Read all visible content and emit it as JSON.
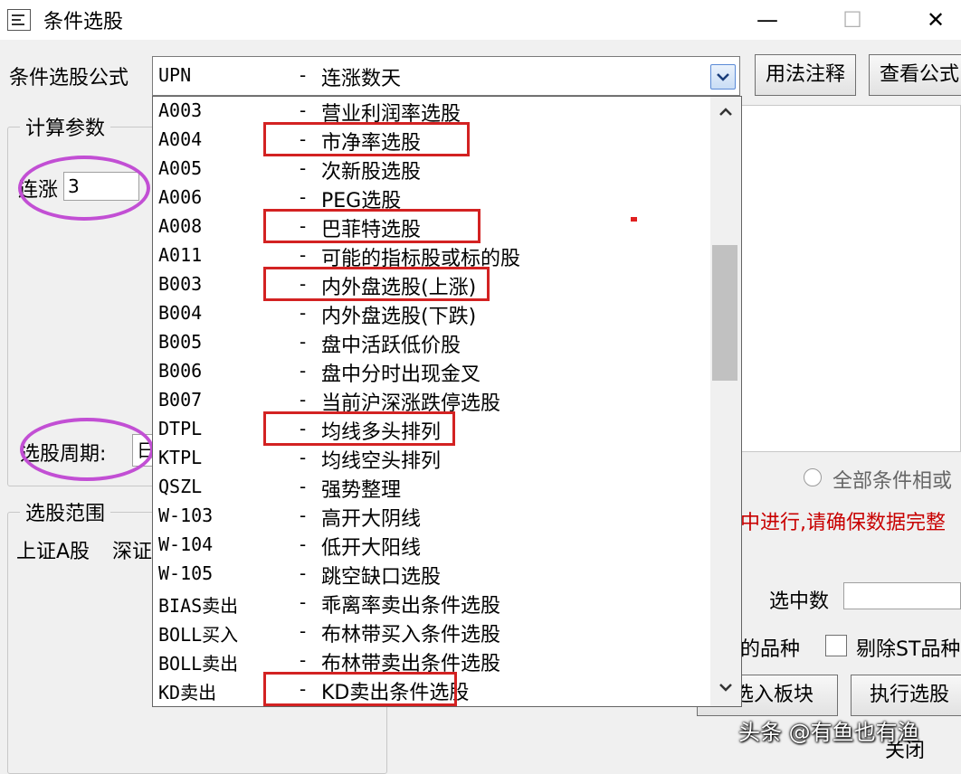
{
  "window": {
    "title": "条件选股",
    "minimize_glyph": "—",
    "maximize_glyph": "☐",
    "close_glyph": "✕"
  },
  "formula": {
    "label": "条件选股公式",
    "selected_code": "UPN",
    "selected_dash": "-",
    "selected_name": "连涨数天"
  },
  "buttons": {
    "usage_notes": "用法注释",
    "view_formula": "查看公式",
    "add_to_block": "选入板块",
    "execute": "执行选股"
  },
  "calc_params": {
    "group_label": "计算参数",
    "lianzhang_label": "连涨",
    "lianzhang_value": "3",
    "period_label": "选股周期:",
    "period_value": "日"
  },
  "range": {
    "group_label": "选股范围",
    "sh_a": "上证A股",
    "sz": "深证"
  },
  "right_panel": {
    "all_conditions": "全部条件相或",
    "warning": "中进行,请确保数据完整",
    "selected_count_label": "选中数",
    "variety_label": "的品种",
    "exclude_st": "剔除ST品种",
    "close": "关闭"
  },
  "dropdown": {
    "options": [
      {
        "code": "A003",
        "name": "营业利润率选股",
        "highlighted": false
      },
      {
        "code": "A004",
        "name": "市净率选股",
        "highlighted": true
      },
      {
        "code": "A005",
        "name": "次新股选股",
        "highlighted": false
      },
      {
        "code": "A006",
        "name": "PEG选股",
        "highlighted": false
      },
      {
        "code": "A008",
        "name": "巴菲特选股",
        "highlighted": true
      },
      {
        "code": "A011",
        "name": "可能的指标股或标的股",
        "highlighted": false
      },
      {
        "code": "B003",
        "name": "内外盘选股(上涨)",
        "highlighted": true
      },
      {
        "code": "B004",
        "name": "内外盘选股(下跌)",
        "highlighted": false
      },
      {
        "code": "B005",
        "name": "盘中活跃低价股",
        "highlighted": false
      },
      {
        "code": "B006",
        "name": "盘中分时出现金叉",
        "highlighted": false
      },
      {
        "code": "B007",
        "name": "当前沪深涨跌停选股",
        "highlighted": false
      },
      {
        "code": "DTPL",
        "name": "均线多头排列",
        "highlighted": true
      },
      {
        "code": "KTPL",
        "name": "均线空头排列",
        "highlighted": false
      },
      {
        "code": "QSZL",
        "name": "强势整理",
        "highlighted": false
      },
      {
        "code": "W-103",
        "name": "高开大阴线",
        "highlighted": false
      },
      {
        "code": "W-104",
        "name": "低开大阳线",
        "highlighted": false
      },
      {
        "code": "W-105",
        "name": "跳空缺口选股",
        "highlighted": false
      },
      {
        "code": "BIAS卖出",
        "name": "乖离率卖出条件选股",
        "highlighted": false
      },
      {
        "code": "BOLL买入",
        "name": "布林带买入条件选股",
        "highlighted": false
      },
      {
        "code": "BOLL卖出",
        "name": "布林带卖出条件选股",
        "highlighted": false
      },
      {
        "code": "KD卖出",
        "name": "KD卖出条件选股",
        "highlighted": true
      }
    ],
    "dash": "-"
  },
  "watermark": "头条 @有鱼也有渔",
  "colors": {
    "highlight_box": "#d32222",
    "annotation_ellipse": "#c24fd4",
    "warning_text": "#c80000"
  }
}
